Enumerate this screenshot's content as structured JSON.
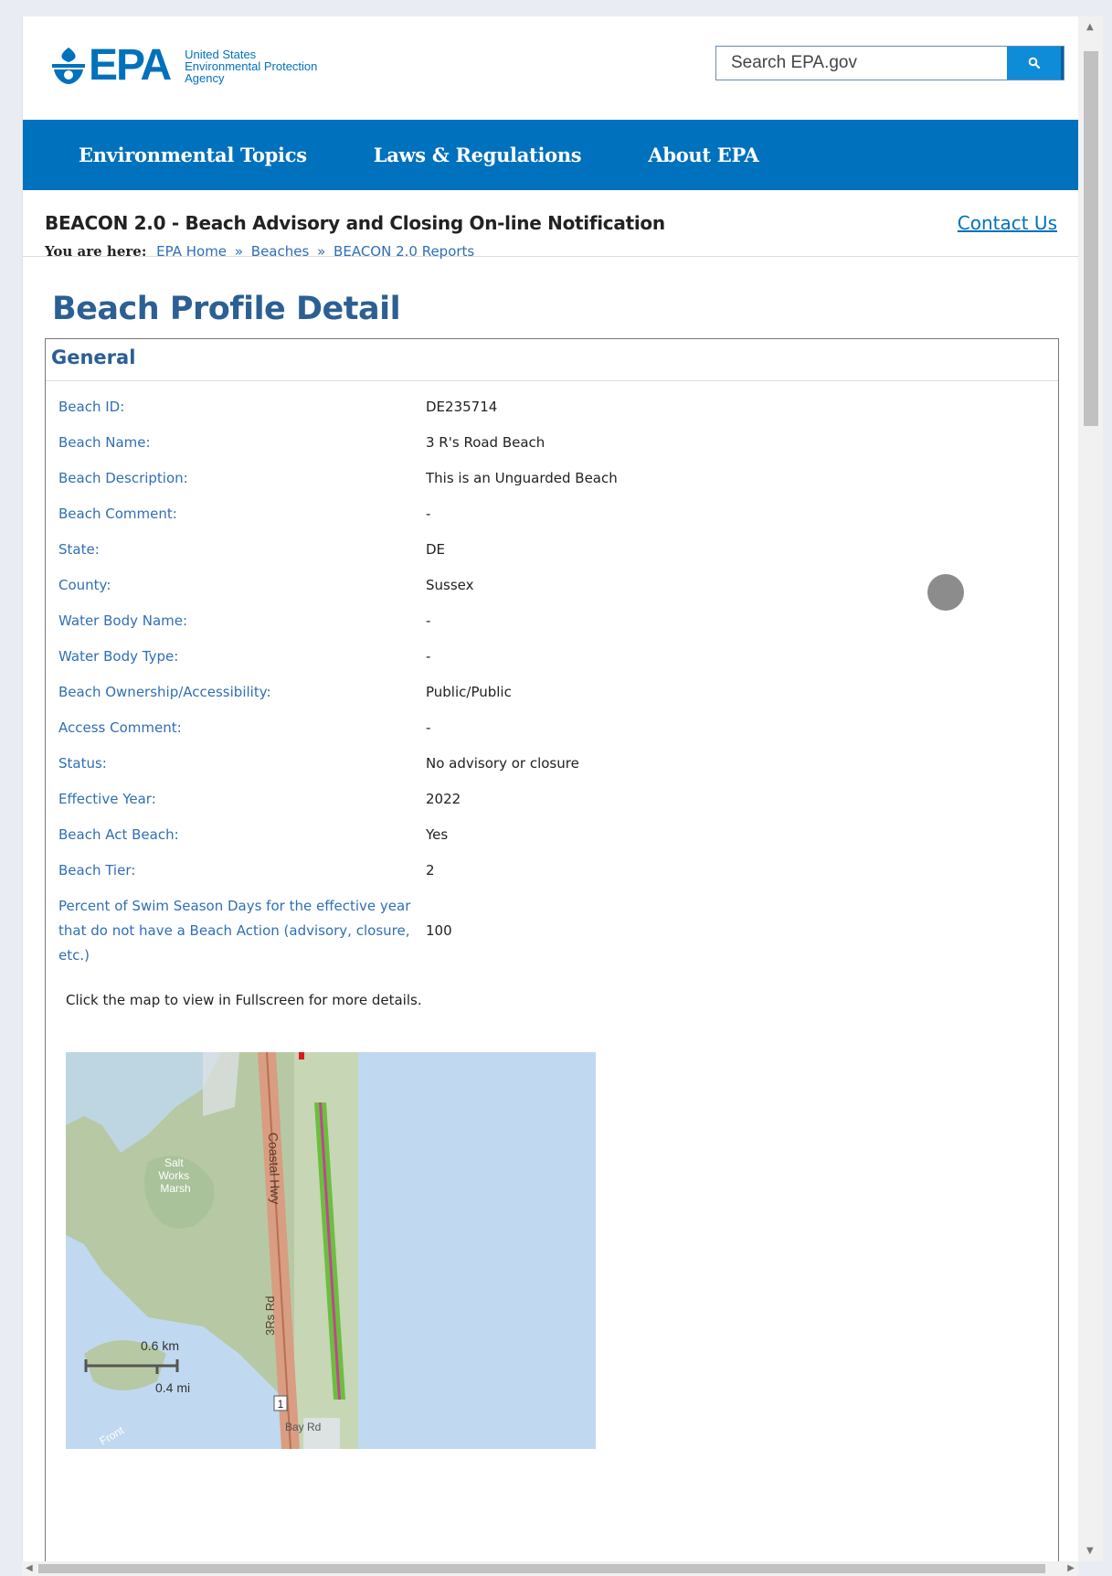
{
  "header": {
    "logo_text": "EPA",
    "agency_lines": [
      "United States",
      "Environmental Protection",
      "Agency"
    ],
    "search_placeholder": "Search EPA.gov"
  },
  "nav": {
    "items": [
      "Environmental Topics",
      "Laws & Regulations",
      "About EPA"
    ]
  },
  "app": {
    "title": "BEACON 2.0 - Beach Advisory and Closing On-line Notification",
    "contact_label": "Contact Us"
  },
  "breadcrumb": {
    "label": "You are here:",
    "links": [
      "EPA Home",
      "Beaches",
      "BEACON 2.0 Reports"
    ],
    "separator": "»"
  },
  "page": {
    "title": "Beach Profile Detail"
  },
  "general": {
    "heading": "General",
    "rows": [
      {
        "label": "Beach ID:",
        "value": "DE235714"
      },
      {
        "label": "Beach Name:",
        "value": "3 R's Road Beach"
      },
      {
        "label": "Beach Description:",
        "value": "This is an Unguarded Beach"
      },
      {
        "label": "Beach Comment:",
        "value": "-"
      },
      {
        "label": "State:",
        "value": "DE"
      },
      {
        "label": "County:",
        "value": "Sussex"
      },
      {
        "label": "Water Body Name:",
        "value": "-"
      },
      {
        "label": "Water Body Type:",
        "value": "-"
      },
      {
        "label": "Beach Ownership/Accessibility:",
        "value": "Public/Public"
      },
      {
        "label": "Access Comment:",
        "value": "-"
      },
      {
        "label": "Status:",
        "value": "No advisory or closure"
      },
      {
        "label": "Effective Year:",
        "value": "2022"
      },
      {
        "label": "Beach Act Beach:",
        "value": "Yes"
      },
      {
        "label": "Beach Tier:",
        "value": "2"
      },
      {
        "label": "Percent of Swim Season Days for the effective year that do not have a Beach Action (advisory, closure, etc.)",
        "value": "100"
      }
    ]
  },
  "map": {
    "note": "Click the map to view in Fullscreen for more details.",
    "labels": {
      "marsh": [
        "Salt",
        "Works",
        "Marsh"
      ],
      "highway": "Coastal Hwy",
      "road": "3Rs Rd",
      "route": "1",
      "bay_rd": "Bay Rd",
      "front": "Front",
      "scale_km": "0.6 km",
      "scale_mi": "0.4 mi"
    },
    "colors": {
      "water": "#c0d9f0",
      "land": "#b6c9a4",
      "highway": "#d99d82",
      "beach_line": "#6abf3f",
      "beach_center": "#c0478f"
    }
  },
  "colors": {
    "epa_blue": "#0071bc",
    "link_blue": "#2f6fb5",
    "heading_blue": "#2c5f93"
  }
}
